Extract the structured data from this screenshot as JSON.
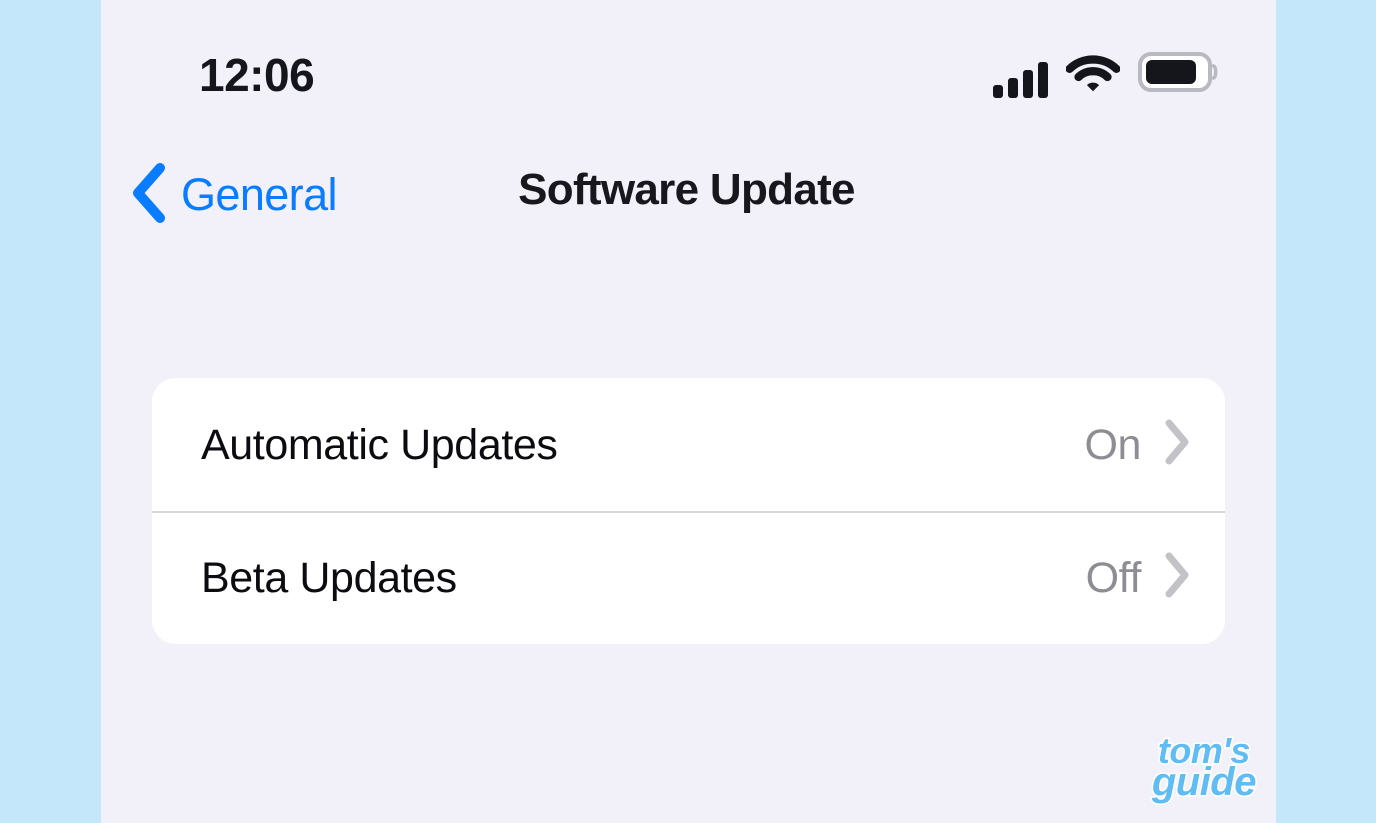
{
  "theme": {
    "page_backdrop_color": "#c4e8fa",
    "screen_background_color": "#f2f1f9",
    "card_background_color": "#ffffff",
    "accent_blue": "#0a7cff",
    "secondary_text_color": "#8d8d93",
    "chevron_color": "#c2c2c7",
    "separator_color": "#d6d6dc",
    "watermark_color": "#60bdf3"
  },
  "status_bar": {
    "time": "12:06",
    "signal_icon": "cellular-signal-icon",
    "signal_bars_filled": 4,
    "signal_bars_total": 4,
    "wifi_icon": "wifi-icon",
    "wifi_bars_filled": 3,
    "battery_icon": "battery-icon",
    "battery_level_percent": 75
  },
  "nav_bar": {
    "back_label": "General",
    "back_icon": "chevron-left-icon",
    "title": "Software Update"
  },
  "settings": {
    "rows": [
      {
        "label": "Automatic Updates",
        "value": "On",
        "chevron_icon": "chevron-right-icon"
      },
      {
        "label": "Beta Updates",
        "value": "Off",
        "chevron_icon": "chevron-right-icon"
      }
    ]
  },
  "watermark": {
    "line1": "tom's",
    "line2": "guide"
  }
}
